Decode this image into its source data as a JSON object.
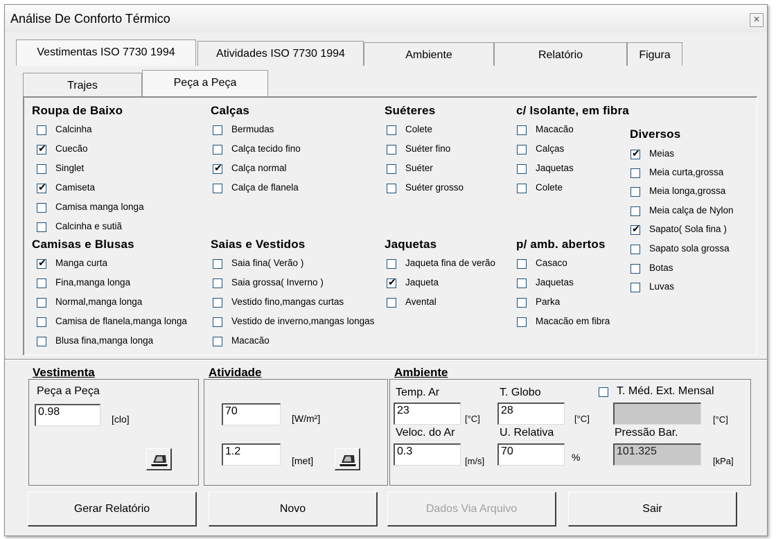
{
  "window": {
    "title": "Análise De Conforto Térmico",
    "close_glyph": "✕"
  },
  "tabs": [
    "Vestimentas ISO 7730 1994",
    "Atividades ISO 7730 1994",
    "Ambiente",
    "Relatório",
    "Figura"
  ],
  "subtabs": [
    "Trajes",
    "Peça a Peça"
  ],
  "groups": [
    {
      "title": "Roupa de Baixo",
      "items": [
        {
          "label": "Calcinha",
          "checked": false
        },
        {
          "label": "Cuecão",
          "checked": true
        },
        {
          "label": "Singlet",
          "checked": false
        },
        {
          "label": "Camiseta",
          "checked": true
        },
        {
          "label": "Camisa manga longa",
          "checked": false
        },
        {
          "label": "Calcinha e sutiã",
          "checked": false
        }
      ]
    },
    {
      "title": "Calças",
      "items": [
        {
          "label": "Bermudas",
          "checked": false
        },
        {
          "label": "Calça tecido fino",
          "checked": false
        },
        {
          "label": "Calça normal",
          "checked": true
        },
        {
          "label": "Calça de flanela",
          "checked": false
        }
      ]
    },
    {
      "title": "Suéteres",
      "items": [
        {
          "label": "Colete",
          "checked": false
        },
        {
          "label": "Suéter fino",
          "checked": false
        },
        {
          "label": "Suéter",
          "checked": false
        },
        {
          "label": "Suéter grosso",
          "checked": false
        }
      ]
    },
    {
      "title": "c/ Isolante, em fibra",
      "items": [
        {
          "label": "Macacão",
          "checked": false
        },
        {
          "label": "Calças",
          "checked": false
        },
        {
          "label": "Jaquetas",
          "checked": false
        },
        {
          "label": "Colete",
          "checked": false
        }
      ]
    },
    {
      "title": "Diversos",
      "items": [
        {
          "label": "Meias",
          "checked": true
        },
        {
          "label": "Meia curta,grossa",
          "checked": false
        },
        {
          "label": "Meia longa,grossa",
          "checked": false
        },
        {
          "label": "Meia calça de Nylon",
          "checked": false
        },
        {
          "label": "Sapato( Sola fina )",
          "checked": true
        },
        {
          "label": "Sapato sola grossa",
          "checked": false
        },
        {
          "label": "Botas",
          "checked": false
        },
        {
          "label": "Luvas",
          "checked": false
        }
      ]
    },
    {
      "title": "Camisas e Blusas",
      "items": [
        {
          "label": "Manga curta",
          "checked": true
        },
        {
          "label": "Fina,manga longa",
          "checked": false
        },
        {
          "label": "Normal,manga longa",
          "checked": false
        },
        {
          "label": "Camisa de flanela,manga longa",
          "checked": false
        },
        {
          "label": "Blusa fina,manga longa",
          "checked": false
        }
      ]
    },
    {
      "title": "Saias e Vestidos",
      "items": [
        {
          "label": "Saia fina( Verão )",
          "checked": false
        },
        {
          "label": "Saia grossa( Inverno )",
          "checked": false
        },
        {
          "label": "Vestido fino,mangas curtas",
          "checked": false
        },
        {
          "label": "Vestido de inverno,mangas longas",
          "checked": false
        },
        {
          "label": "Macacão",
          "checked": false
        }
      ]
    },
    {
      "title": "Jaquetas",
      "items": [
        {
          "label": "Jaqueta fina de verão",
          "checked": false
        },
        {
          "label": "Jaqueta",
          "checked": true
        },
        {
          "label": "Avental",
          "checked": false
        }
      ]
    },
    {
      "title": "p/ amb. abertos",
      "items": [
        {
          "label": "Casaco",
          "checked": false
        },
        {
          "label": "Jaquetas",
          "checked": false
        },
        {
          "label": "Parka",
          "checked": false
        },
        {
          "label": "Macacão em fibra",
          "checked": false
        }
      ]
    }
  ],
  "vestimenta": {
    "header": "Vestimenta",
    "label": "Peça a Peça",
    "value": "0.98",
    "unit": "[clo]"
  },
  "atividade": {
    "header": "Atividade",
    "value1": "70",
    "unit1": "[W/m²]",
    "value2": "1.2",
    "unit2": "[met]"
  },
  "ambiente": {
    "header": "Ambiente",
    "temp_label": "Temp. Ar",
    "temp_value": "23",
    "temp_unit": "[°C]",
    "globo_label": "T. Globo",
    "globo_value": "28",
    "globo_unit": "[°C]",
    "tmed_label": "T. Méd. Ext. Mensal",
    "tmed_checked": false,
    "tmed_value": "",
    "tmed_unit": "[°C]",
    "veloc_label": "Veloc. do Ar",
    "veloc_value": "0.3",
    "veloc_unit": "[m/s]",
    "ur_label": "U. Relativa",
    "ur_value": "70",
    "ur_unit": "%",
    "press_label": "Pressão Bar.",
    "press_value": "101.325",
    "press_unit": "[kPa]"
  },
  "buttons": {
    "gerar": "Gerar Relatório",
    "novo": "Novo",
    "dados": "Dados Via Arquivo",
    "sair": "Sair"
  },
  "icons": {
    "calc": "hand-calculator-icon"
  }
}
